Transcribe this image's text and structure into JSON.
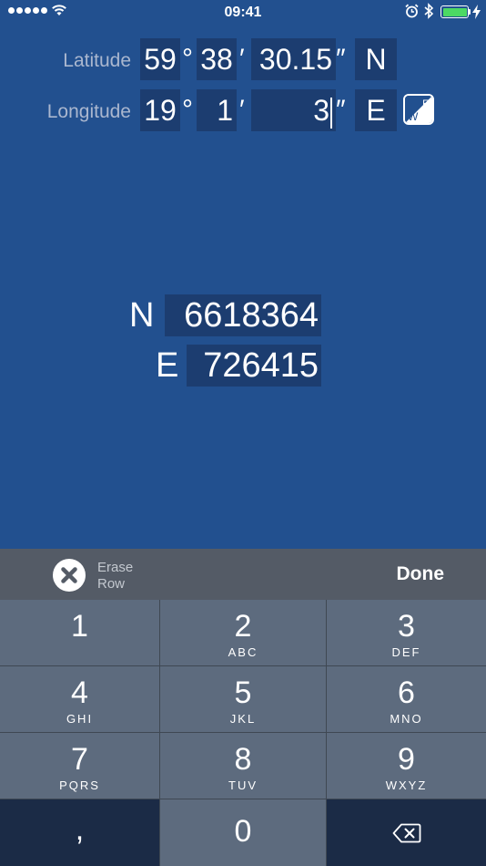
{
  "status_bar": {
    "time": "09:41"
  },
  "latitude": {
    "label": "Latitude",
    "degrees": "59",
    "minutes": "38",
    "seconds": "30.15",
    "hemisphere": "N"
  },
  "longitude": {
    "label": "Longitude",
    "degrees": "19",
    "minutes": "1",
    "seconds": "3",
    "hemisphere": "E"
  },
  "units": {
    "degree": "°",
    "minute": "′",
    "second": "″"
  },
  "hemisphere_toggle": {
    "top": "E",
    "bottom": "W"
  },
  "result": {
    "north_letter": "N",
    "north_value": "6618364",
    "east_letter": "E",
    "east_value": "726415"
  },
  "toolbar": {
    "erase_label_1": "Erase",
    "erase_label_2": "Row",
    "done_label": "Done"
  },
  "keypad": {
    "keys": [
      {
        "num": "1",
        "letters": ""
      },
      {
        "num": "2",
        "letters": "ABC"
      },
      {
        "num": "3",
        "letters": "DEF"
      },
      {
        "num": "4",
        "letters": "GHI"
      },
      {
        "num": "5",
        "letters": "JKL"
      },
      {
        "num": "6",
        "letters": "MNO"
      },
      {
        "num": "7",
        "letters": "PQRS"
      },
      {
        "num": "8",
        "letters": "TUV"
      },
      {
        "num": "9",
        "letters": "WXYZ"
      }
    ],
    "comma": ",",
    "zero": "0"
  },
  "colors": {
    "background": "#22508f",
    "field": "#1c3d70",
    "keyboard_toolbar": "#545b66",
    "key": "#5d6b7e",
    "key_dark": "#1b2b46",
    "battery": "#4cd964"
  },
  "icons": [
    "signal-icon",
    "wifi-icon",
    "alarm-icon",
    "bluetooth-icon",
    "battery-icon",
    "charging-icon",
    "hemisphere-toggle-icon",
    "erase-icon",
    "backspace-icon"
  ]
}
